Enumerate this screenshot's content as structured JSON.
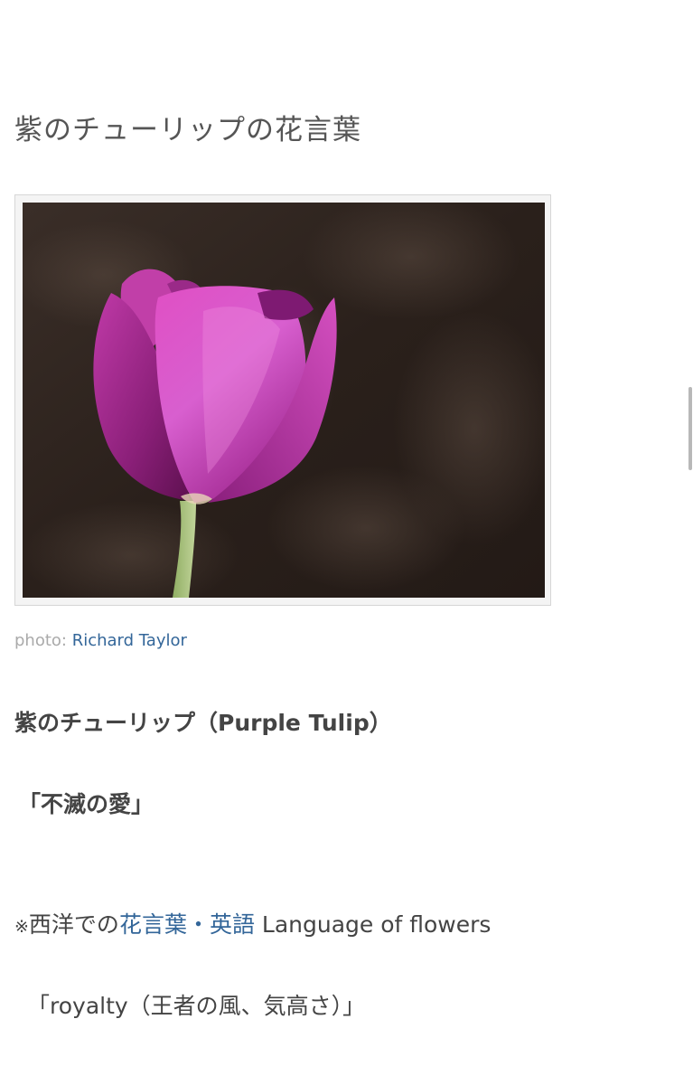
{
  "article": {
    "heading": "紫のチューリップの花言葉",
    "photo": {
      "alt_icon": "purple-tulip-photo",
      "credit_prefix": "photo:",
      "credit_author": "Richard Taylor"
    },
    "flower_name": "紫のチューリップ（Purple Tulip）",
    "meaning_jp": "「不滅の愛」",
    "western": {
      "prefix_mark": "※",
      "prefix_text": "西洋での",
      "link_label": "花言葉・英語",
      "suffix_text": " Language of flowers"
    },
    "meaning_en": "「royalty（王者の風、気高さ）」"
  },
  "colors": {
    "text": "#444444",
    "link": "#336699",
    "credit": "#aaaaaa"
  }
}
